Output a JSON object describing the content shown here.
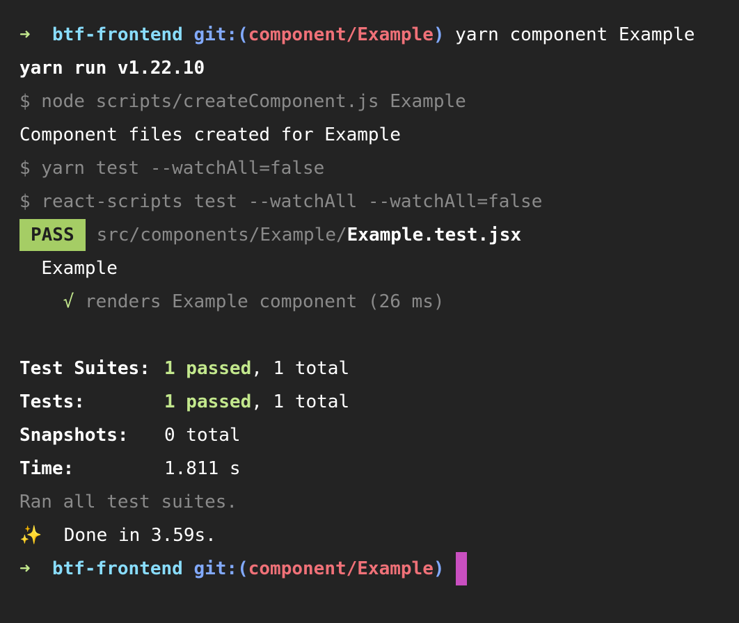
{
  "prompt": {
    "arrow": "➜",
    "dir": "btf-frontend",
    "git_open": "git:(",
    "branch": "component/Example",
    "git_close": ")",
    "command": "yarn component Example"
  },
  "lines": {
    "yarn_run": "yarn run v1.22.10",
    "node_cmd": "$ node scripts/createComponent.js Example",
    "created": "Component files created for Example",
    "yarn_test": "$ yarn test --watchAll=false",
    "react_scripts": "$ react-scripts test --watchAll --watchAll=false"
  },
  "test_result": {
    "badge": "PASS",
    "path_prefix": "src/components/Example/",
    "file": "Example.test.jsx",
    "suite_name": "Example",
    "check": "√",
    "case": "renders Example component (26 ms)"
  },
  "summary": {
    "suites_label": "Test Suites:",
    "suites_passed": "1 passed",
    "suites_rest": ", 1 total",
    "tests_label": "Tests:",
    "tests_passed": "1 passed",
    "tests_rest": ", 1 total",
    "snapshots_label": "Snapshots:",
    "snapshots_value": "0 total",
    "time_label": "Time:",
    "time_value": "1.811 s",
    "ran_all": "Ran all test suites."
  },
  "done": {
    "sparkle": "✨",
    "text": "Done in 3.59s."
  },
  "colors": {
    "background": "#232323",
    "arrow": "#c3e88d",
    "dir": "#89ddff",
    "git": "#82aaff",
    "branch": "#f07178",
    "pass_badge": "#a5cd65",
    "cursor": "#c94fc0"
  }
}
